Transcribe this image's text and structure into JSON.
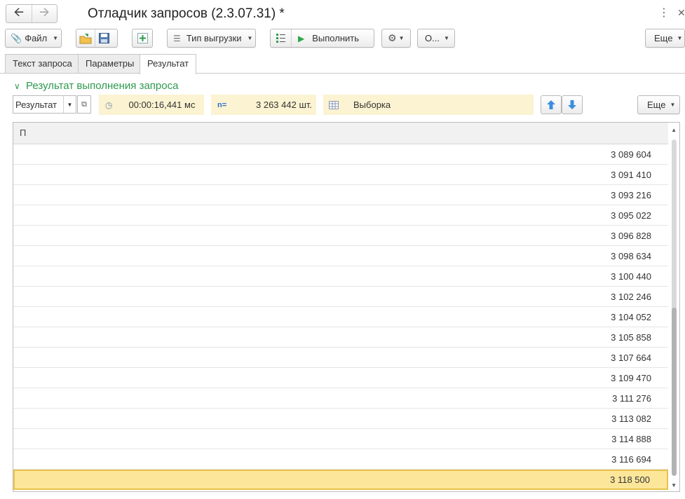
{
  "window": {
    "title": "Отладчик запросов (2.3.07.31) *",
    "menu_icon": "kebab-menu-icon",
    "close_icon": "close-icon"
  },
  "toolbar": {
    "file_label": "Файл",
    "export_type_label": "Тип выгрузки",
    "execute_label": "Выполнить",
    "o_label": "О...",
    "more_label": "Еще"
  },
  "tabs": [
    {
      "label": "Текст запроса",
      "active": false
    },
    {
      "label": "Параметры",
      "active": false
    },
    {
      "label": "Результат",
      "active": true
    }
  ],
  "result": {
    "group_title": "Результат выполнения запроса",
    "result_select": "Результат",
    "execution_time": "00:00:16,441 мс",
    "row_count": "3 263 442 шт.",
    "result_kind": "Выборка",
    "more_label": "Еще",
    "column_header": "П",
    "rows": [
      "3 089 604",
      "3 091 410",
      "3 093 216",
      "3 095 022",
      "3 096 828",
      "3 098 634",
      "3 100 440",
      "3 102 246",
      "3 104 052",
      "3 105 858",
      "3 107 664",
      "3 109 470",
      "3 111 276",
      "3 113 082",
      "3 114 888",
      "3 116 694",
      "3 118 500"
    ],
    "selected_row_index": 16
  },
  "colors": {
    "accent_green": "#2e9a4f",
    "info_background": "#fbf3d1",
    "selection": "#fbe69a",
    "arrow_blue": "#3a8ee0"
  }
}
